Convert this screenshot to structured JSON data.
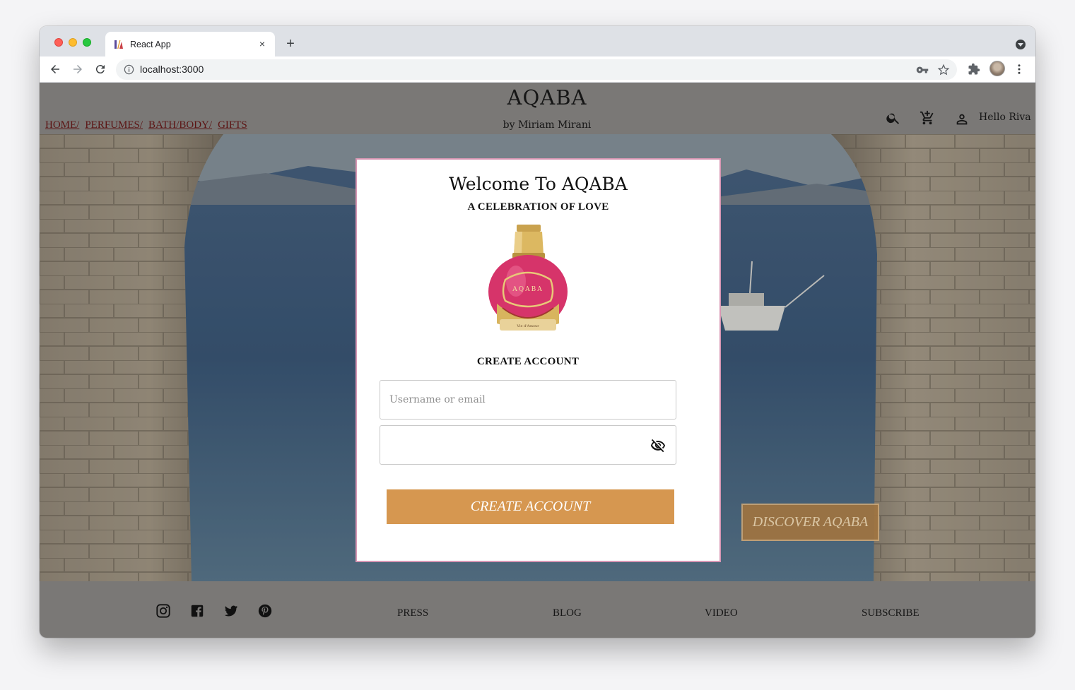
{
  "browser": {
    "tab_title": "React App",
    "tab_close": "×",
    "new_tab": "+",
    "url": "localhost:3000"
  },
  "site": {
    "brand": "AQABA",
    "byline": "by Miriam Mirani",
    "nav": [
      "HOME/",
      "PERFUMES/",
      "BATH/BODY/",
      "GIFTS"
    ],
    "greeting": "Hello Riva",
    "header_icons": [
      "search-icon",
      "add-to-cart-icon",
      "account-icon"
    ]
  },
  "hero": {
    "discover_label": "DISCOVER AQABA"
  },
  "modal": {
    "title": "Welcome To AQABA",
    "subtitle": "A CELEBRATION OF LOVE",
    "bottle_label": "AQABA",
    "bottle_small": "Vie d'Amour",
    "heading": "CREATE ACCOUNT",
    "username_placeholder": "Username or email",
    "password_value": "",
    "submit_label": "CREATE ACCOUNT"
  },
  "footer": {
    "social": [
      "instagram-icon",
      "facebook-icon",
      "twitter-icon",
      "pinterest-icon"
    ],
    "links": [
      "PRESS",
      "BLOG",
      "VIDEO",
      "SUBSCRIBE"
    ]
  },
  "colors": {
    "header_bg": "#7a7876",
    "modal_border": "#d796b3",
    "button_bg": "#d69750",
    "nav_link": "#5c1414"
  }
}
